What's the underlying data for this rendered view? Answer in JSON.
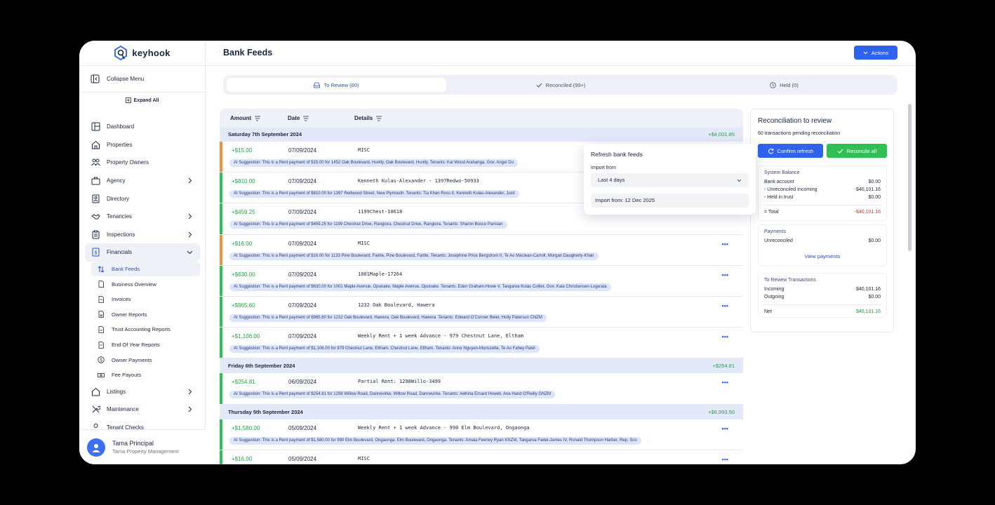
{
  "app": {
    "logo_text": "keyhook",
    "page_title": "Bank Feeds",
    "actions_label": "Actions"
  },
  "sidebar": {
    "collapse_label": "Collapse Menu",
    "expand_all_label": "Expand All",
    "items": [
      {
        "label": "Dashboard",
        "icon": "dashboard-icon"
      },
      {
        "label": "Properties",
        "icon": "home-icon"
      },
      {
        "label": "Property Owners",
        "icon": "people-icon"
      },
      {
        "label": "Agency",
        "icon": "briefcase-icon"
      },
      {
        "label": "Directory",
        "icon": "directory-icon"
      },
      {
        "label": "Tenancies",
        "icon": "handshake-icon"
      },
      {
        "label": "Inspections",
        "icon": "clipboard-icon"
      },
      {
        "label": "Financials",
        "icon": "dollar-doc-icon"
      }
    ],
    "financials_sub": [
      {
        "label": "Bank Feeds"
      },
      {
        "label": "Business Overview"
      },
      {
        "label": "Invoices"
      },
      {
        "label": "Owner Reports"
      },
      {
        "label": "Trust Accounting Reports"
      },
      {
        "label": "End Of Year Reports"
      },
      {
        "label": "Owner Payments"
      },
      {
        "label": "Fee Payouts"
      }
    ],
    "items_after": [
      {
        "label": "Listings"
      },
      {
        "label": "Maintenance"
      },
      {
        "label": "Tenant Checks"
      }
    ],
    "user": {
      "name": "Tama Principal",
      "org": "Tama Property Management"
    }
  },
  "tabs": [
    {
      "label": "To Review (60)"
    },
    {
      "label": "Reconciled (99+)"
    },
    {
      "label": "Held (0)"
    }
  ],
  "table": {
    "headers": {
      "amount": "Amount",
      "date": "Date",
      "details": "Details"
    },
    "groups": [
      {
        "label": "Saturday 7th September 2024",
        "total": "+$4,001.85"
      },
      {
        "label": "Friday 6th September 2024",
        "total": "+$254.81"
      },
      {
        "label": "Thursday 5th September 2024",
        "total": "+$6,993.50"
      }
    ],
    "rows": [
      {
        "amount": "+$15.00",
        "date": "07/09/2024",
        "details": "MISC",
        "ai": "AI Suggestion: This is a Rent payment of $15.00 for 1452 Oak Boulevard, Huntly, Oak Boulevard, Huntly. Tenants: Kai Wood Arahanga, Gov. Angel Do"
      },
      {
        "amount": "+$810.00",
        "date": "07/09/2024",
        "details": "Kenneth Kulas-Alexander - 1397Redwo-50933",
        "ai": "AI Suggestion: This is a Rent payment of $810.00 for 1397 Redwood Street, New Plymouth. Tenants: Tia Khan Ross II, Kenneth Kulas-Alexander, Justi"
      },
      {
        "amount": "+$459.25",
        "date": "07/09/2024",
        "details": "1199Chest-10618",
        "ai": "AI Suggestion: This is a Rent payment of $459.25 for 1199 Chestnut Drive, Rangiora, Chestnut Drive, Rangiora. Tenants: Sharon Bosco Parisian"
      },
      {
        "amount": "+$16.00",
        "date": "07/09/2024",
        "details": "MISC",
        "ai": "AI Suggestion: This is a Rent payment of $16.00 for 1133 Pine Boulevard, Fairlie, Pine Boulevard, Fairlie. Tenants: Josephine Price Bergstrom II, Te Ao Maclean-Carroll, Morgan Daugherty-Khan"
      },
      {
        "amount": "+$630.00",
        "date": "07/09/2024",
        "details": "1001Maple-17264",
        "ai": "AI Suggestion: This is a Rent payment of $630.00 for 1001 Maple Avenue, Opunake, Maple Avenue, Opunake. Tenants: Eden Graham-Howe V, Tangaroa Kulas Collier, Gov. Kaia Christiansen-Loga'ata"
      },
      {
        "amount": "+$965.60",
        "date": "07/09/2024",
        "details": "1232 Oak Boulevard, Hawera",
        "ai": "AI Suggestion: This is a Rent payment of $965.60 for 1232 Oak Boulevard, Hawera, Oak Boulevard, Hawera. Tenants: Edward O'Conner Beier, Holly Paterson CNZM"
      },
      {
        "amount": "+$1,106.00",
        "date": "07/09/2024",
        "details": "Weekly Rent + 1 week Advance - 979 Chestnut Lane, Eltham",
        "ai": "AI Suggestion: This is a Rent payment of $1,106.00 for 979 Chestnut Lane, Eltham, Chestnut Lane, Eltham. Tenants: Anne Nguyen-Morissette, Te Ao Fahey Patel"
      },
      {
        "amount": "+$254.81",
        "date": "06/09/2024",
        "details": "Partial Rent: 1298Willo-3499",
        "ai": "AI Suggestion: This is a Rent payment of $254.81 for 1298 Willow Road, Dannevirke, Willow Road, Dannevirke. Tenants: Awhina Ernard Howell, Ana Hand O'Reilly GNZM"
      },
      {
        "amount": "+$1,580.00",
        "date": "05/09/2024",
        "details": "Weekly Rent + 1 week Advance - 990 Elm Boulevard, Ongaonga",
        "ai": "AI Suggestion: This is a Rent payment of $1,580.00 for 990 Elm Boulevard, Ongaonga, Elm Boulevard, Ongaonga. Tenants: Amaia Feeney Ryan KNZM, Tangaroa Fadel-James IV, Ronald Thompson Harber, Rep. Sco"
      },
      {
        "amount": "+$16.00",
        "date": "05/09/2024",
        "details": "MISC",
        "ai": ""
      }
    ],
    "colors": {
      "orange": "#f2913d",
      "green": "#2fbf55"
    }
  },
  "popover": {
    "title": "Refresh bank feeds",
    "import_label": "Import from",
    "select_value": "Last 4 days",
    "import_from": "Import from: 12 Dec 2025"
  },
  "panel": {
    "title": "Reconciliation to review",
    "subtitle": "60 transactions pending reconciliation",
    "confirm_label": "Confirm refresh",
    "reconcile_label": "Reconcile all",
    "system_balance": {
      "title": "System Balance",
      "bank_account_label": "Bank account",
      "bank_account": "$0.00",
      "unreconciled_label": "- Unreconciled Incoming",
      "unreconciled": "$40,101.16",
      "held_label": "- Held in trust",
      "held": "$0.00",
      "total_label": "= Total",
      "total": "-$40,101.16"
    },
    "payments": {
      "title": "Payments",
      "unreconciled_label": "Unreconciled",
      "unreconciled": "$0.00",
      "link": "View payments"
    },
    "to_review": {
      "title": "To Review Transactions",
      "incoming_label": "Incoming",
      "incoming": "$40,101.16",
      "outgoing_label": "Outgoing",
      "outgoing": "$0.00",
      "net_label": "Net",
      "net": "$40,101.16"
    }
  }
}
